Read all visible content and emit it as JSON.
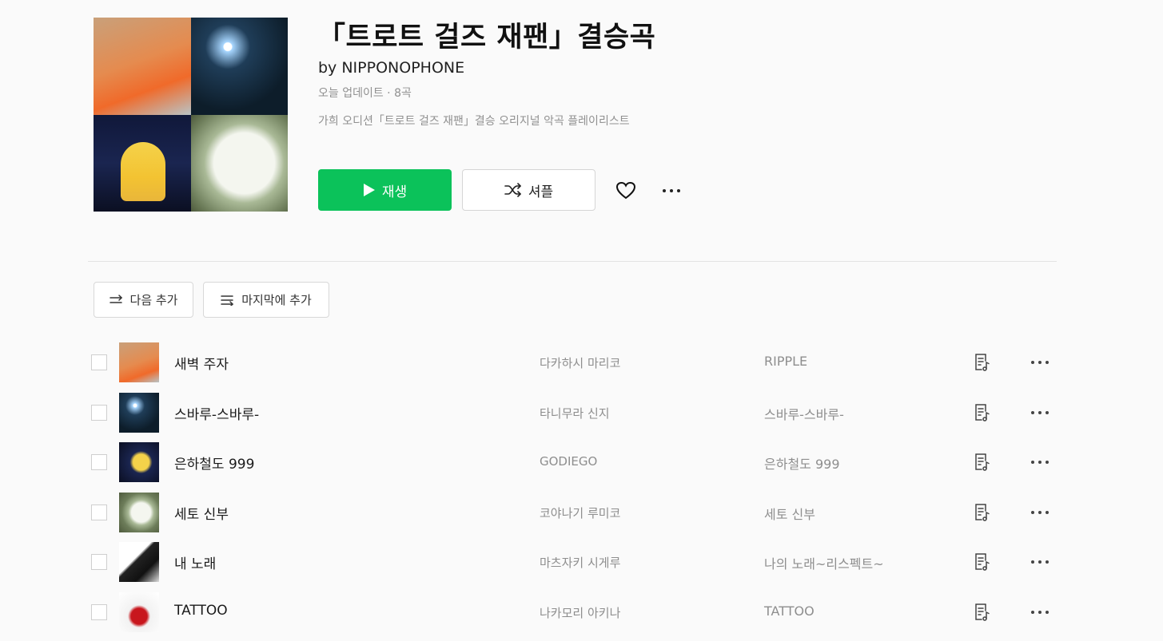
{
  "playlist": {
    "title": "「트로트 걸즈 재팬」결승곡",
    "byline": "by NIPPONOPHONE",
    "meta": "오늘 업데이트 · 8곡",
    "description": "가희 오디션「트로트 걸즈 재팬」결승 오리지널 악곡 플레이리스트"
  },
  "actions": {
    "play_label": "재생",
    "shuffle_label": "셔플",
    "add_next_label": "다음 추가",
    "add_last_label": "마지막에 추가"
  },
  "tracks": [
    {
      "title": "새벽 주자",
      "artist": "다카하시 마리코",
      "album": "RIPPLE"
    },
    {
      "title": "스바루-스바루-",
      "artist": "타니무라 신지",
      "album": "스바루-스바루-"
    },
    {
      "title": "은하철도 999",
      "artist": "GODIEGO",
      "album": "은하철도 999"
    },
    {
      "title": "세토 신부",
      "artist": "코야나기 루미코",
      "album": "세토 신부"
    },
    {
      "title": "내 노래",
      "artist": "마츠자키 시게루",
      "album": "나의 노래~리스펙트~"
    },
    {
      "title": "TATTOO",
      "artist": "나카모리 아키나",
      "album": "TATTOO"
    }
  ],
  "colors": {
    "accent": "#0bc25a",
    "muted_text": "#8e8e8e"
  },
  "icons": {
    "play": "play-icon",
    "shuffle": "shuffle-icon",
    "like": "heart-icon",
    "more": "more-icon",
    "add_next": "add-next-icon",
    "add_last": "add-last-icon",
    "lyrics": "lyrics-icon"
  }
}
